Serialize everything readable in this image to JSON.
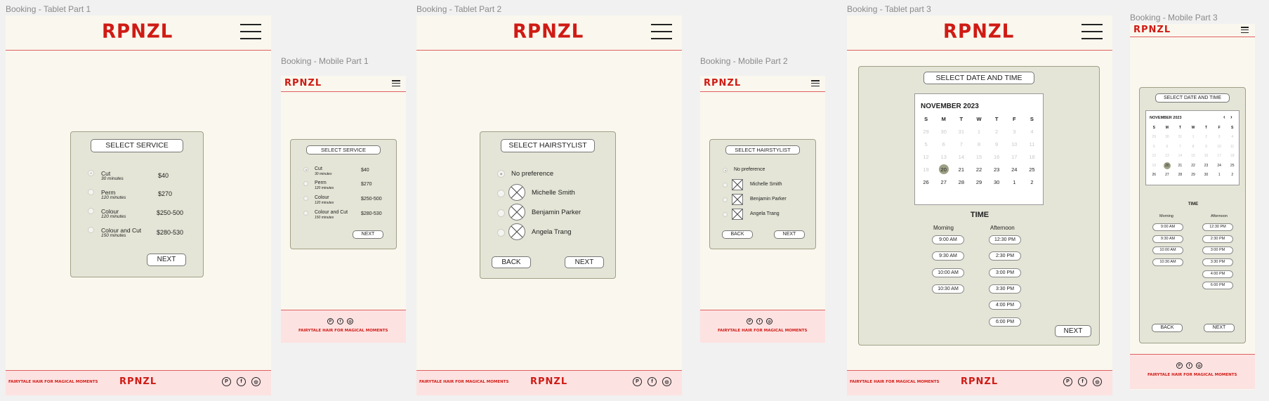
{
  "brand": {
    "logo": "RPNZL",
    "tagline": "FAIRYTALE HAIR FOR MAGICAL MOMENTS"
  },
  "frames": {
    "t1": "Booking - Tablet Part 1",
    "m1": "Booking - Mobile Part 1",
    "t2": "Booking - Tablet Part 2",
    "m2": "Booking - Mobile Part 2",
    "t3": "Booking - Tablet part 3",
    "m3": "Booking - Mobile Part 3"
  },
  "service": {
    "title": "SELECT SERVICE",
    "items": [
      {
        "name": "Cut",
        "duration": "30 minutes",
        "price": "$40"
      },
      {
        "name": "Perm",
        "duration": "120 minutes",
        "price": "$270"
      },
      {
        "name": "Colour",
        "duration": "120 minutes",
        "price": "$250-500"
      },
      {
        "name": "Colour and Cut",
        "duration": "150 minutes",
        "price": "$280-530"
      }
    ],
    "next": "NEXT"
  },
  "stylist": {
    "title": "SELECT HAIRSTYLIST",
    "no_pref": "No preference",
    "items": [
      "Michelle Smith",
      "Benjamin Parker",
      "Angela Trang"
    ],
    "back": "BACK",
    "next": "NEXT"
  },
  "datetime": {
    "title": "SELECT DATE AND TIME",
    "month": "NOVEMBER 2023",
    "dow": [
      "S",
      "M",
      "T",
      "W",
      "T",
      "F",
      "S"
    ],
    "weeks": [
      [
        "29",
        "30",
        "31",
        "1",
        "2",
        "3",
        "4"
      ],
      [
        "5",
        "6",
        "7",
        "8",
        "9",
        "10",
        "11"
      ],
      [
        "12",
        "13",
        "14",
        "15",
        "16",
        "17",
        "18"
      ],
      [
        "19",
        "20",
        "21",
        "22",
        "23",
        "24",
        "25"
      ],
      [
        "26",
        "27",
        "28",
        "29",
        "30",
        "1",
        "2"
      ]
    ],
    "selected_day": "20",
    "time_label": "TIME",
    "morning_label": "Morning",
    "afternoon_label": "Afternoon",
    "morning": [
      "9:00 AM",
      "9:30 AM",
      "10:00 AM",
      "10:30 AM"
    ],
    "afternoon": [
      "12:30 PM",
      "2:30 PM",
      "3:00 PM",
      "3:30 PM",
      "4:00 PM",
      "6:00 PM"
    ],
    "back": "BACK",
    "next": "NEXT"
  },
  "social_icons": [
    "pinterest-icon",
    "facebook-icon",
    "instagram-icon"
  ],
  "colors": {
    "brand_red": "#cf1b14",
    "card_bg": "#e4e5d6",
    "footer_bg": "#fde2e2",
    "page_bg": "#faf7ee",
    "selected_day": "#9ea086"
  }
}
